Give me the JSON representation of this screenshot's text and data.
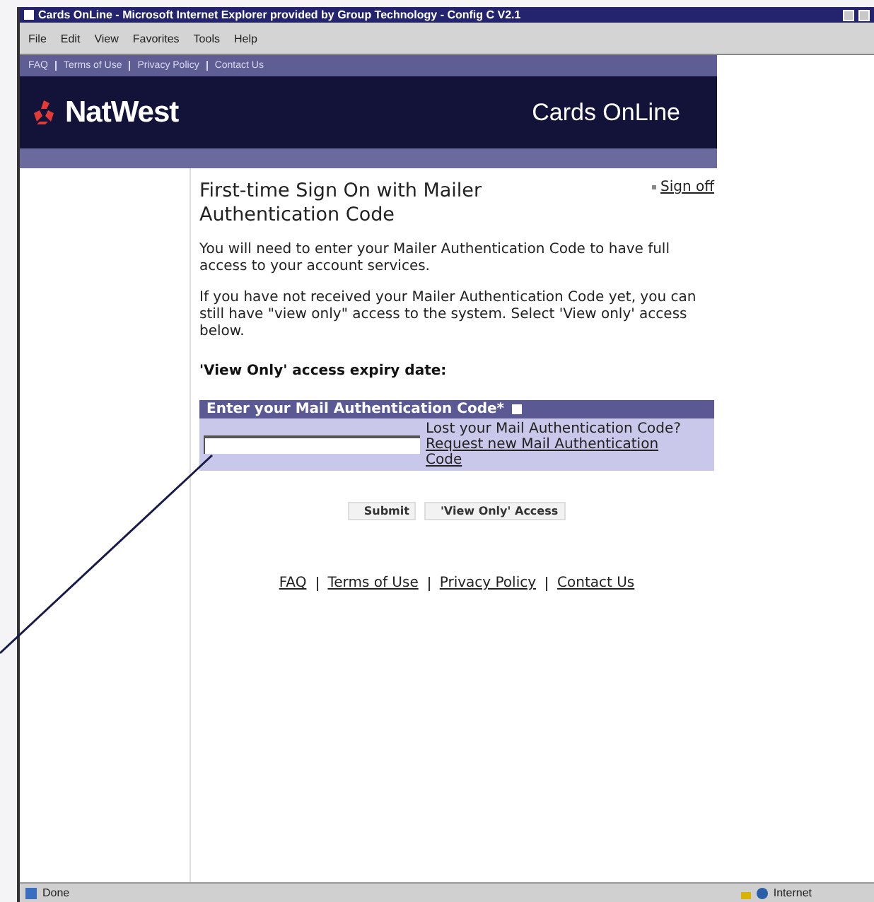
{
  "window": {
    "title": "Cards OnLine - Microsoft Internet Explorer provided by Group Technology - Config C V2.1"
  },
  "menu": [
    "File",
    "Edit",
    "View",
    "Favorites",
    "Tools",
    "Help"
  ],
  "top_links": [
    "FAQ",
    "Terms of Use",
    "Privacy Policy",
    "Contact Us"
  ],
  "header": {
    "brand": "NatWest",
    "product": "Cards OnLine"
  },
  "page": {
    "title": "First-time Sign On with Mailer Authentication Code",
    "sign_off": "Sign off",
    "paragraphs": [
      "You will need to enter your Mailer Authentication Code to have full access to your account services.",
      "If you have not received your Mailer Authentication Code yet, you can still have \"view only\" access to the system. Select 'View only' access below."
    ],
    "expiry_label": "'View Only' access expiry date:"
  },
  "code_box": {
    "heading": "Enter your Mail Authentication Code*",
    "lost_text": "Lost your Mail Authentication Code?",
    "request_link": "Request new Mail Authentication Code"
  },
  "buttons": [
    "Submit",
    "'View Only' Access"
  ],
  "footer_links": [
    "FAQ",
    "Terms of Use",
    "Privacy Policy",
    "Contact Us"
  ],
  "status_bar": {
    "status": "Done",
    "zone": "Internet"
  }
}
